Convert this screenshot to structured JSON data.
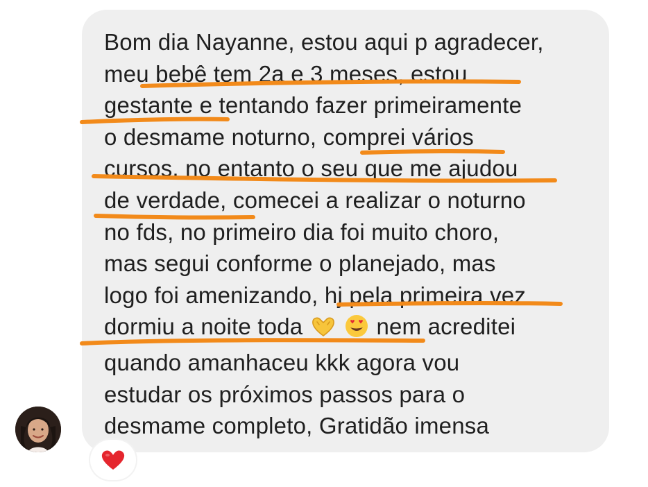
{
  "message": {
    "lines": [
      "Bom dia Nayanne, estou aqui p agradecer,",
      "meu bebê tem 2a e 3 meses, estou",
      "gestante e tentando fazer primeiramente",
      "o desmame noturno, comprei vários",
      "cursos, no entanto o seu que me ajudou",
      "de verdade, comecei a realizar o noturno",
      "no fds, no primeiro dia foi muito choro,",
      "mas segui conforme o planejado, mas",
      "logo foi amenizando, hj pela primeira vez",
      "nem acreditei",
      "quando amanhaceu kkk agora vou",
      "estudar os próximos passos para o",
      "desmame completo, Gratidão imensa"
    ],
    "line10_prefix": "dormiu a noite toda",
    "inline_emojis": [
      "heart-hands-emoji",
      "heart-eyes-emoji"
    ]
  },
  "reaction": {
    "icon": "red-heart-icon"
  },
  "colors": {
    "bubble": "#efefef",
    "text": "#1f1f1f",
    "highlight": "#f28a1a",
    "reaction_heart": "#e5262e"
  }
}
